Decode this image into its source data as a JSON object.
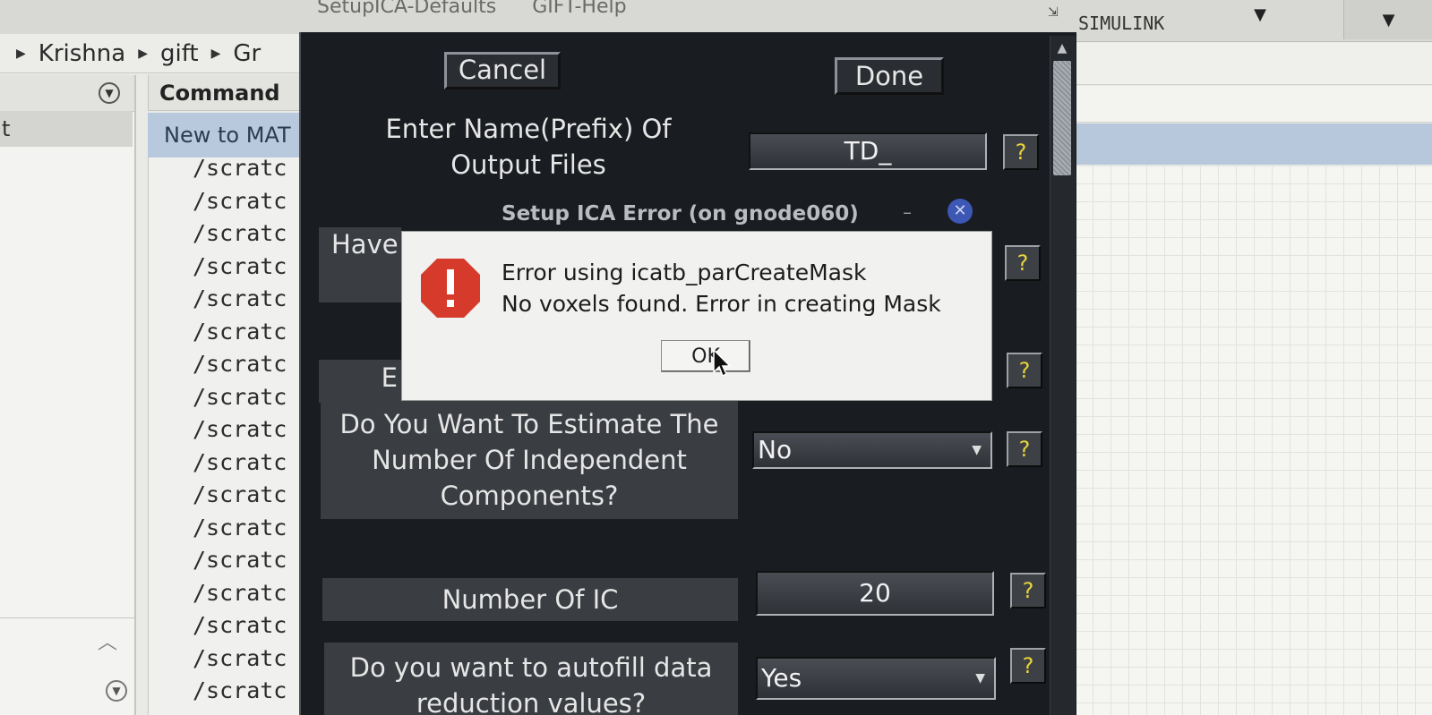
{
  "background": {
    "breadcrumb": [
      "Krishna",
      "gift",
      "Gr"
    ],
    "left_panel": {
      "selected_row": "t"
    },
    "command_window": {
      "header": "Command",
      "banner": "New to MAT",
      "lines": [
        "/scratc",
        "/scratc",
        "/scratc",
        "/scratc",
        "/scratc",
        "/scratc",
        "/scratc",
        "/scratc",
        "/scratc",
        "/scratc",
        "/scratc",
        "/scratc",
        "/scratc",
        "/scratc",
        "/scratc",
        "/scratc",
        "/scratc"
      ]
    },
    "right_toolbar": {
      "simulink": "SIMULINK"
    }
  },
  "ica_window": {
    "titlebar": {
      "item1": "SetupICA-Defaults",
      "item2": "GIFT-Help"
    },
    "cancel_label": "Cancel",
    "done_label": "Done",
    "help_label": "?",
    "fields": {
      "prefix_label": "Enter Name(Prefix) Of Output Files",
      "prefix_value": "TD_",
      "have_label": "Have",
      "partial_label": "E",
      "estimate_label": "Do You Want To Estimate The Number Of Independent Components?",
      "estimate_value": "No",
      "num_ic_label": "Number Of IC",
      "num_ic_value": "20",
      "autofill_label": "Do you want to autofill data reduction values?",
      "autofill_value": "Yes"
    }
  },
  "error_dialog": {
    "title": "Setup ICA Error (on gnode060)",
    "line1": "Error using icatb_parCreateMask",
    "line2": "No voxels found. Error in creating Mask",
    "ok_label": "OK",
    "icon": "error-stop-icon",
    "icon_color": "#d63a2a",
    "close_color": "#3d57b5"
  }
}
